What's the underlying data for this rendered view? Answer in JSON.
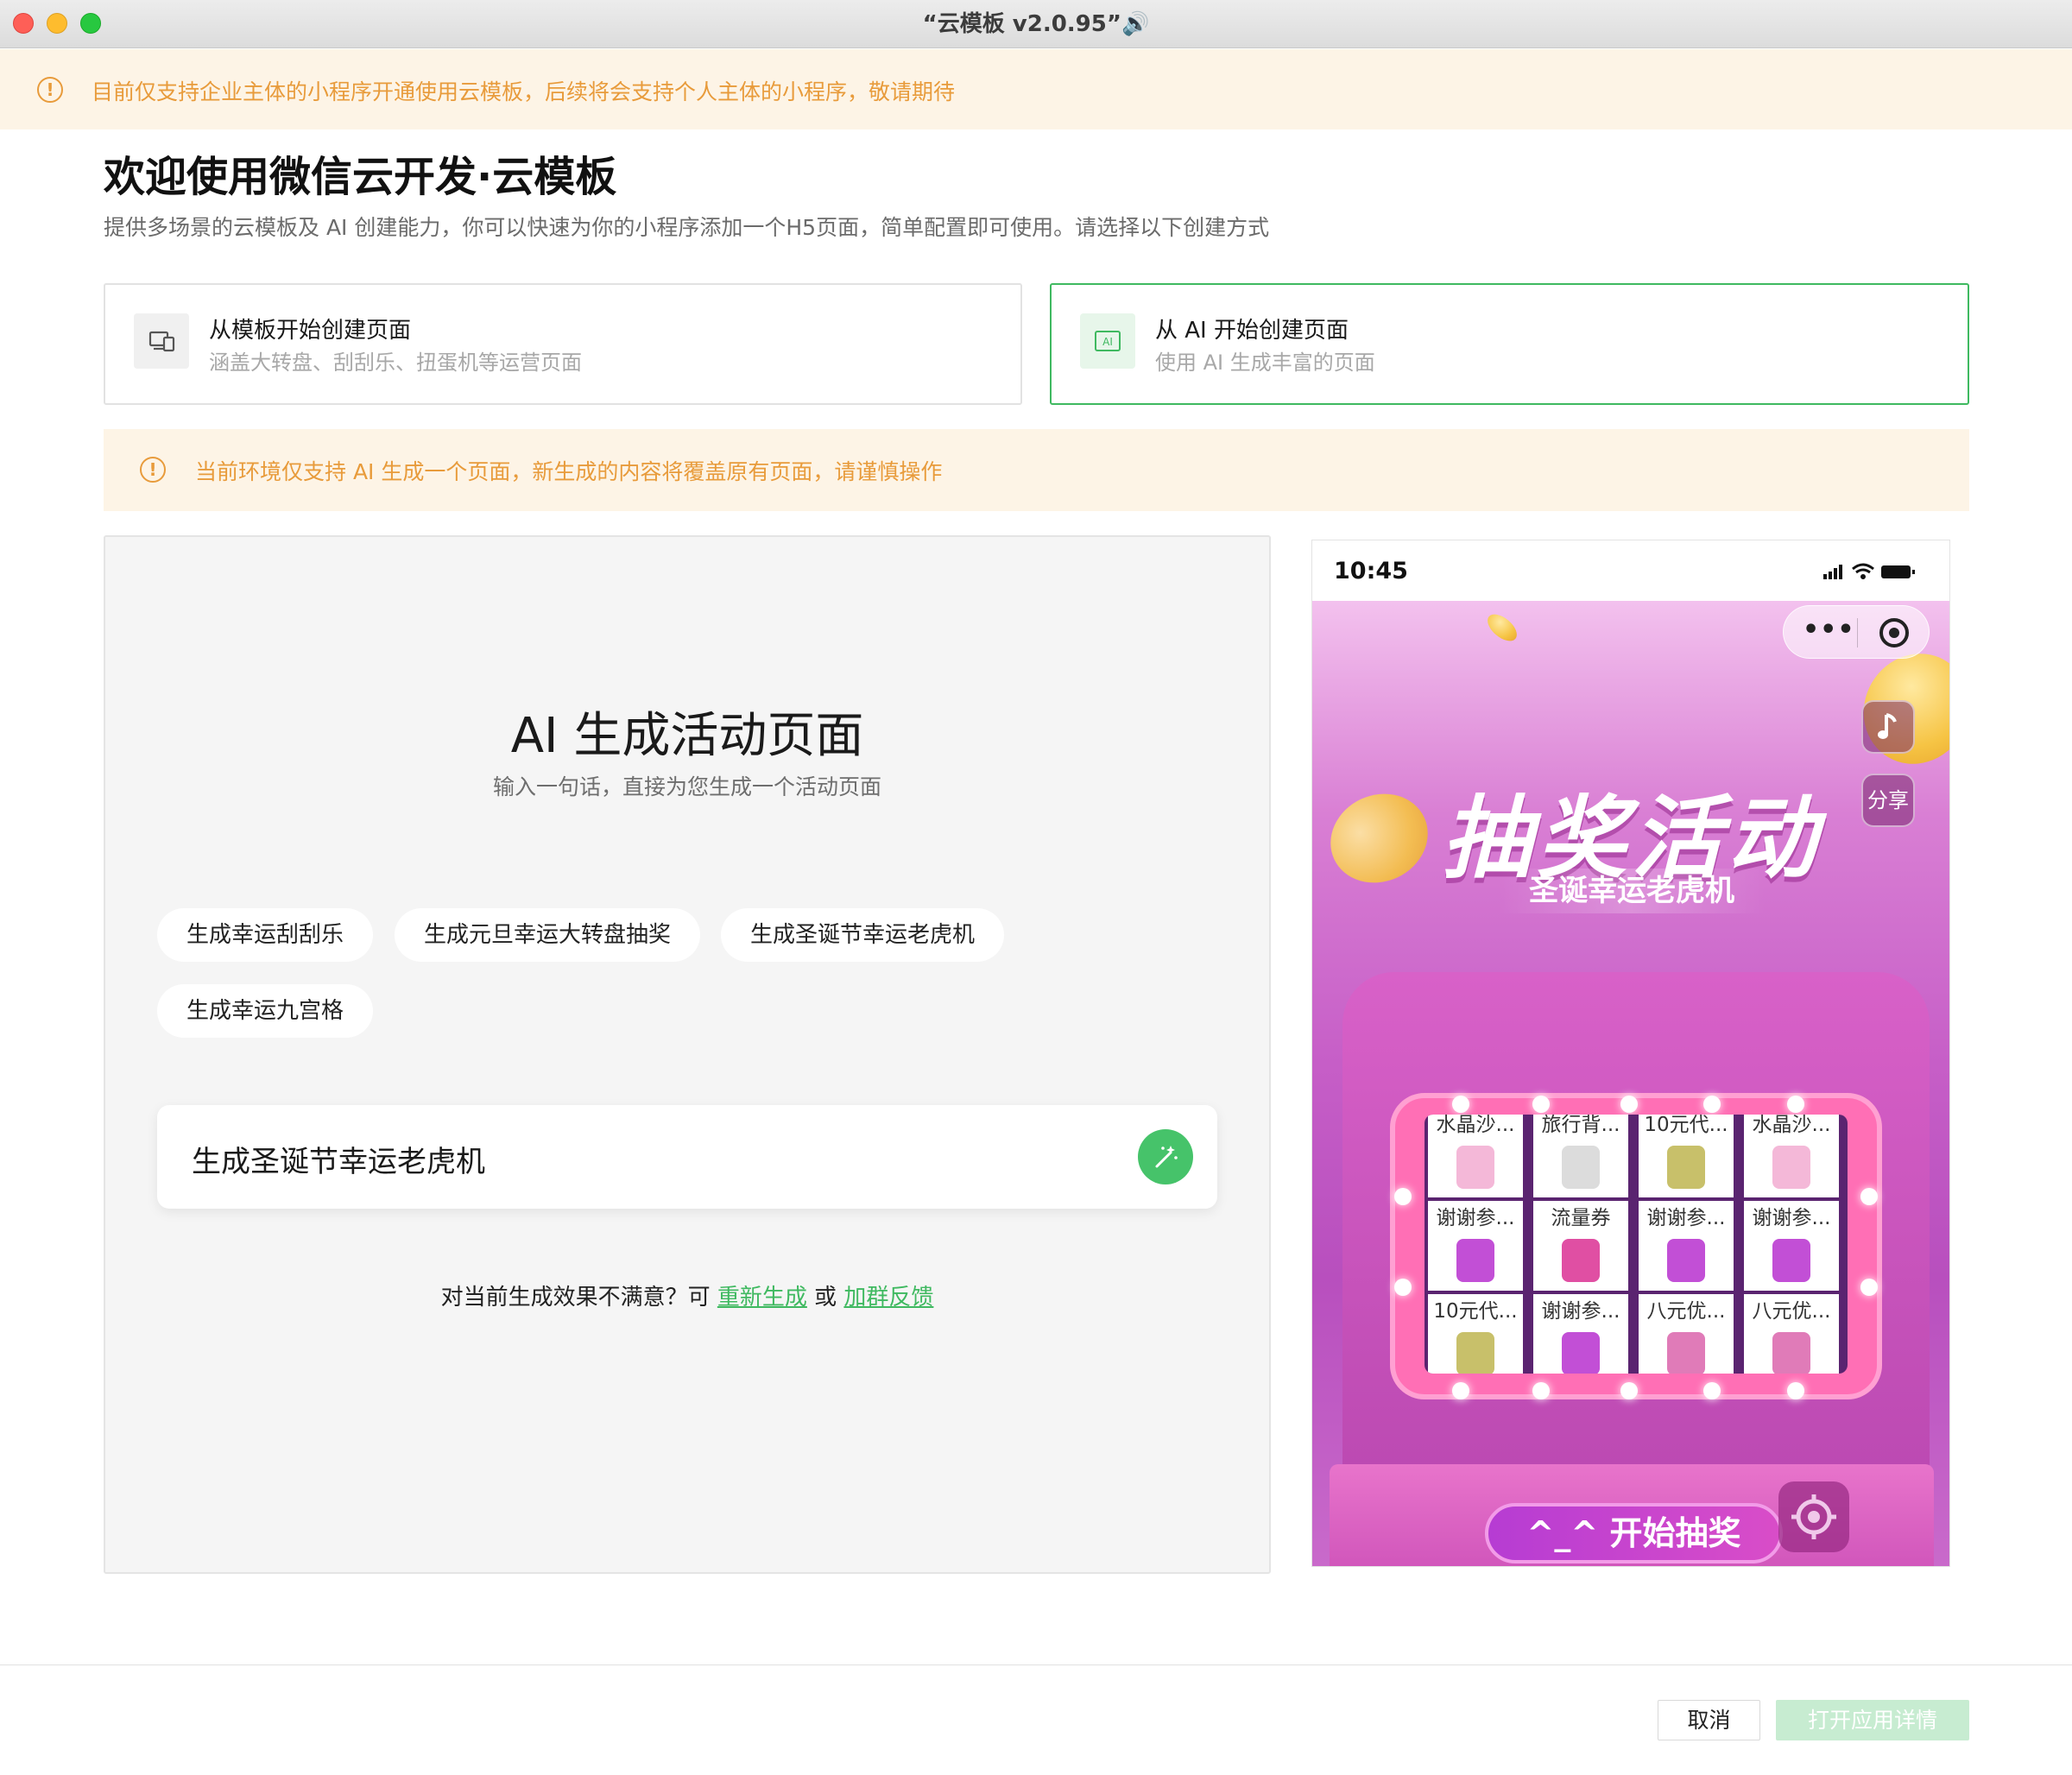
{
  "window": {
    "title": "“云模板 v2.0.95”🔊"
  },
  "top_notice": {
    "text": "目前仅支持企业主体的小程序开通使用云模板，后续将会支持个人主体的小程序，敬请期待"
  },
  "header": {
    "title": "欢迎使用微信云开发·云模板",
    "subtitle": "提供多场景的云模板及 AI 创建能力，你可以快速为你的小程序添加一个H5页面，简单配置即可使用。请选择以下创建方式"
  },
  "modes": [
    {
      "title": "从模板开始创建页面",
      "desc": "涵盖大转盘、刮刮乐、扭蛋机等运营页面",
      "icon": "devices-icon",
      "selected": false
    },
    {
      "title": "从 AI 开始创建页面",
      "desc": "使用 AI 生成丰富的页面",
      "icon": "ai-icon",
      "selected": true
    }
  ],
  "env_notice": {
    "text": "当前环境仅支持 AI 生成一个页面，新生成的内容将覆盖原有页面，请谨慎操作"
  },
  "ai_panel": {
    "title": "AI 生成活动页面",
    "subtitle": "输入一句话，直接为您生成一个活动页面",
    "suggestions": [
      "生成幸运刮刮乐",
      "生成元旦幸运大转盘抽奖",
      "生成圣诞节幸运老虎机",
      "生成幸运九宫格"
    ],
    "input_value": "生成圣诞节幸运老虎机",
    "feedback_prefix": "对当前生成效果不满意？可",
    "regenerate_link": "重新生成",
    "or_text": "或",
    "group_feedback_link": "加群反馈"
  },
  "preview": {
    "status_time": "10:45",
    "capsule_more": "•••",
    "share_label": "分享",
    "event_title": "抽奖活动",
    "event_subtitle": "圣诞幸运老虎机",
    "reel_rows": [
      [
        "水晶沙...",
        "旅行背...",
        "10元代...",
        "水晶沙..."
      ],
      [
        "谢谢参...",
        "流量券",
        "谢谢参...",
        "谢谢参..."
      ],
      [
        "10元代...",
        "谢谢参...",
        "八元优...",
        "八元优..."
      ]
    ],
    "start_button": "^_^  开始抽奖",
    "accent_color": "#c65ec7"
  },
  "footer": {
    "cancel": "取消",
    "open_details": "打开应用详情"
  },
  "colors": {
    "accent": "#3fb960",
    "warning": "#e89b3b"
  }
}
